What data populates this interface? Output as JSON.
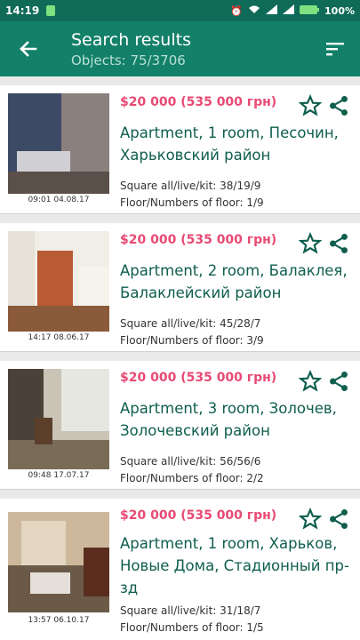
{
  "status": {
    "time": "14:19",
    "battery": "100%"
  },
  "toolbar": {
    "title": "Search results",
    "subtitle": "Objects: 75/3706"
  },
  "listings": [
    {
      "timestamp": "09:01 04.08.17",
      "price": "$20 000 (535 000 грн)",
      "title": "Apartment, 1 room, Песочин, Харьковский район",
      "square": "Square all/live/kit: 38/19/9",
      "floor": "Floor/Numbers of floor: 1/9"
    },
    {
      "timestamp": "14:17 08.06.17",
      "price": "$20 000 (535 000 грн)",
      "title": "Apartment, 2 room, Балаклея, Балаклейский район",
      "square": "Square all/live/kit: 45/28/7",
      "floor": "Floor/Numbers of floor: 3/9"
    },
    {
      "timestamp": "09:48 17.07.17",
      "price": "$20 000 (535 000 грн)",
      "title": "Apartment, 3 room, Золочев, Золочевский район",
      "square": "Square all/live/kit: 56/56/6",
      "floor": "Floor/Numbers of floor: 2/2"
    },
    {
      "timestamp": "13:57 06.10.17",
      "price": "$20 000 (535 000 грн)",
      "title": "Apartment, 1 room, Харьков, Новые Дома, Стадионный пр-зд",
      "square": "Square all/live/kit: 31/18/7",
      "floor": "Floor/Numbers of floor: 1/5"
    }
  ],
  "colors": {
    "primary": "#138069",
    "statusbar": "#106a58",
    "price": "#e84a73",
    "title": "#0f5e4e"
  }
}
